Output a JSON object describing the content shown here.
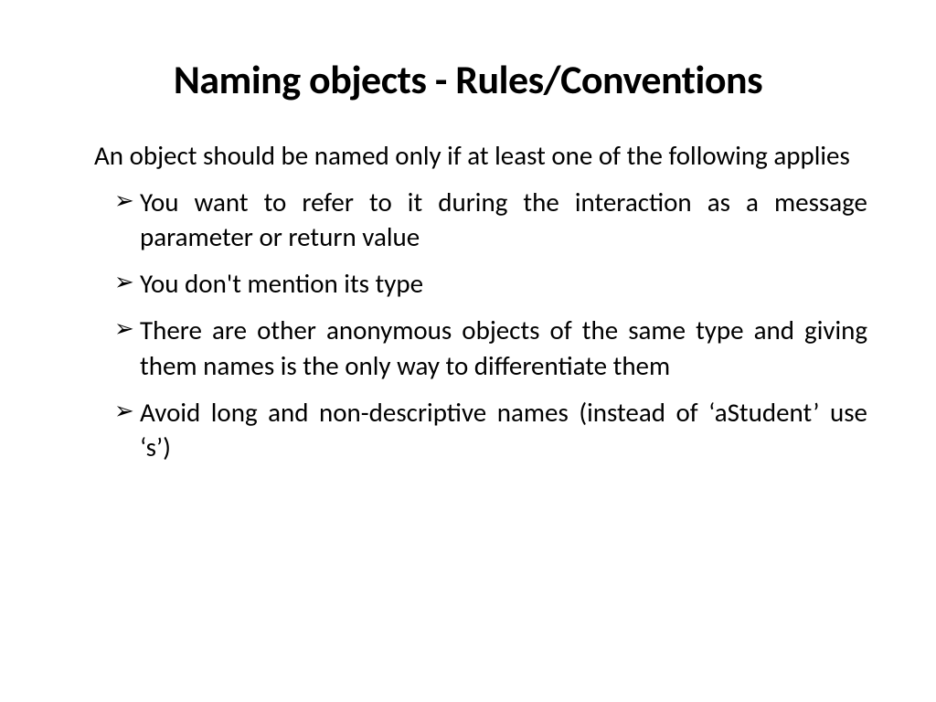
{
  "slide": {
    "title": "Naming objects - Rules/Conventions",
    "intro": "An object should be named only if at least one of the following applies",
    "bullets": [
      "You want to refer to it during the interaction as a message parameter or return value",
      "You don't mention its type",
      "There are other anonymous objects of the same type and giving them names is the only way to differentiate them",
      "Avoid long and non-descriptive names (instead of ‘aStudent’  use ‘s’)"
    ]
  }
}
